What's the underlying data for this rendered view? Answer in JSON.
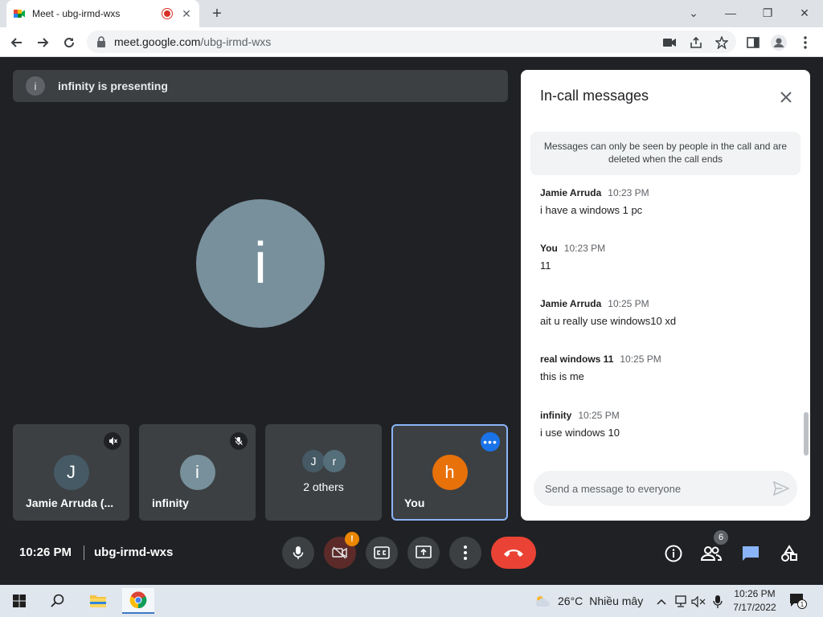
{
  "browser": {
    "tab_title": "Meet - ubg-irmd-wxs",
    "new_tab": "+",
    "url_domain": "meet.google.com",
    "url_path": "/ubg-irmd-wxs",
    "window_controls": {
      "minimize": "⌄",
      "restore": "—",
      "maximize": "❐",
      "close": "✕"
    }
  },
  "meet": {
    "banner_icon_letter": "i",
    "banner_text": "infinity is presenting",
    "presenter_letter": "i",
    "tiles": [
      {
        "letter": "J",
        "name": "Jamie Arruda (...",
        "color": "#455a64"
      },
      {
        "letter": "i",
        "name": "infinity",
        "color": "#78909c"
      },
      {
        "mini": [
          "J",
          "r"
        ],
        "label": "2 others"
      },
      {
        "letter": "h",
        "name": "You",
        "color": "#e8710a"
      }
    ],
    "time": "10:26 PM",
    "meeting_code": "ubg-irmd-wxs",
    "camera_badge": "!",
    "participant_count": "6"
  },
  "chat": {
    "title": "In-call messages",
    "notice": "Messages can only be seen by people in the call and are deleted when the call ends",
    "messages": [
      {
        "sender": "Jamie Arruda",
        "time": "10:23 PM",
        "text": "i have a windows 1 pc"
      },
      {
        "sender": "You",
        "time": "10:23 PM",
        "text": "11"
      },
      {
        "sender": "Jamie Arruda",
        "time": "10:25 PM",
        "text": "ait u really use windows10 xd"
      },
      {
        "sender": "real windows 11",
        "time": "10:25 PM",
        "text": "this is me"
      },
      {
        "sender": "infinity",
        "time": "10:25 PM",
        "text": "i use windows 10"
      }
    ],
    "input_placeholder": "Send a message to everyone"
  },
  "taskbar": {
    "weather_temp": "26°C",
    "weather_desc": "Nhiều mây",
    "clock_time": "10:26 PM",
    "clock_date": "7/17/2022",
    "notification_count": "1"
  },
  "colors": {
    "meet_bg": "#202124",
    "tile_bg": "#3c4043",
    "end_call": "#ea4335",
    "accent_blue": "#1a73e8",
    "you_avatar": "#e8710a"
  }
}
